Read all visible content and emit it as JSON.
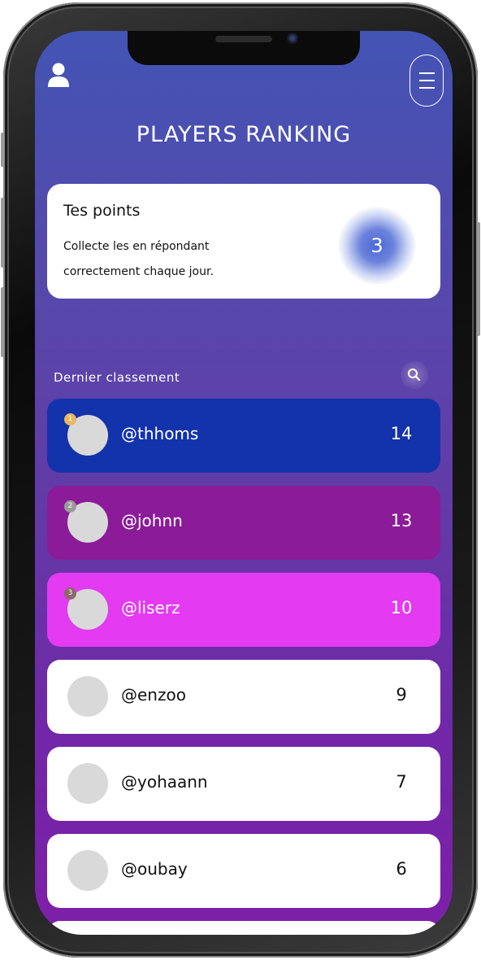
{
  "header": {
    "title": "PLAYERS RANKING"
  },
  "points_card": {
    "title": "Tes points",
    "description": "Collecte les en répondant correctement chaque jour.",
    "value": "3"
  },
  "section": {
    "label": "Dernier classement"
  },
  "ranking": [
    {
      "rank": "1",
      "username": "@thhoms",
      "score": "14",
      "bg": "#1233ac",
      "text_color": "#ffffff",
      "badge_color": "#e8b862"
    },
    {
      "rank": "2",
      "username": "@johnn",
      "score": "13",
      "bg": "#8b1b98",
      "text_color": "#ffffff",
      "badge_color": "#9a9a9a"
    },
    {
      "rank": "3",
      "username": "@liserz",
      "score": "10",
      "bg": "#e33af2",
      "text_color": "#ffffff",
      "badge_color": "#8c6a6a"
    },
    {
      "rank": "",
      "username": "@enzoo",
      "score": "9",
      "bg": "#ffffff",
      "text_color": "#111111",
      "badge_color": ""
    },
    {
      "rank": "",
      "username": "@yohaann",
      "score": "7",
      "bg": "#ffffff",
      "text_color": "#111111",
      "badge_color": ""
    },
    {
      "rank": "",
      "username": "@oubay",
      "score": "6",
      "bg": "#ffffff",
      "text_color": "#111111",
      "badge_color": ""
    },
    {
      "rank": "",
      "username": "",
      "score": "",
      "bg": "#ffffff",
      "text_color": "#111111",
      "badge_color": ""
    }
  ],
  "icons": {
    "user": "user-icon",
    "menu": "menu-icon",
    "search": "search-icon"
  }
}
